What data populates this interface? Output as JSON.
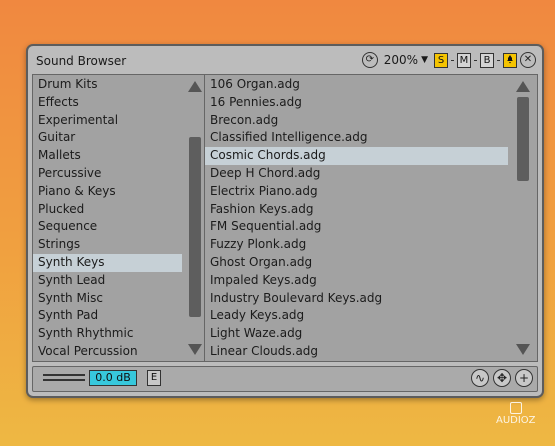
{
  "window": {
    "title": "Sound Browser",
    "zoom": "200%",
    "buttons": {
      "refresh_icon": "⟳",
      "zoom_arrow": "▼",
      "s": "S",
      "m": "M",
      "b": "B",
      "pin_icon": "🔔",
      "close_icon": "✕"
    }
  },
  "categories": [
    {
      "label": "Drum Kits",
      "selected": false
    },
    {
      "label": "Effects",
      "selected": false
    },
    {
      "label": "Experimental",
      "selected": false
    },
    {
      "label": "Guitar",
      "selected": false
    },
    {
      "label": "Mallets",
      "selected": false
    },
    {
      "label": "Percussive",
      "selected": false
    },
    {
      "label": "Piano & Keys",
      "selected": false
    },
    {
      "label": "Plucked",
      "selected": false
    },
    {
      "label": "Sequence",
      "selected": false
    },
    {
      "label": "Strings",
      "selected": false
    },
    {
      "label": "Synth Keys",
      "selected": true
    },
    {
      "label": "Synth Lead",
      "selected": false
    },
    {
      "label": "Synth Misc",
      "selected": false
    },
    {
      "label": "Synth Pad",
      "selected": false
    },
    {
      "label": "Synth Rhythmic",
      "selected": false
    },
    {
      "label": "Vocal Percussion",
      "selected": false
    }
  ],
  "presets": [
    {
      "label": "106 Organ.adg",
      "selected": false
    },
    {
      "label": "16 Pennies.adg",
      "selected": false
    },
    {
      "label": "Brecon.adg",
      "selected": false
    },
    {
      "label": "Classified Intelligence.adg",
      "selected": false
    },
    {
      "label": "Cosmic Chords.adg",
      "selected": true
    },
    {
      "label": "Deep H Chord.adg",
      "selected": false
    },
    {
      "label": "Electrix Piano.adg",
      "selected": false
    },
    {
      "label": "Fashion Keys.adg",
      "selected": false
    },
    {
      "label": "FM Sequential.adg",
      "selected": false
    },
    {
      "label": "Fuzzy Plonk.adg",
      "selected": false
    },
    {
      "label": "Ghost Organ.adg",
      "selected": false
    },
    {
      "label": "Impaled Keys.adg",
      "selected": false
    },
    {
      "label": "Industry Boulevard Keys.adg",
      "selected": false
    },
    {
      "label": "Leady Keys.adg",
      "selected": false
    },
    {
      "label": "Light Waze.adg",
      "selected": false
    },
    {
      "label": "Linear Clouds.adg",
      "selected": false
    }
  ],
  "scroll": {
    "categories_position": 0.18,
    "presets_position": 0.0
  },
  "bottom": {
    "volume": "0.0 dB",
    "e_label": "E",
    "btn_wave_icon": "∿",
    "btn_move_icon": "✥",
    "btn_add_icon": "+"
  },
  "watermark": {
    "text": "AUDIOZ"
  }
}
